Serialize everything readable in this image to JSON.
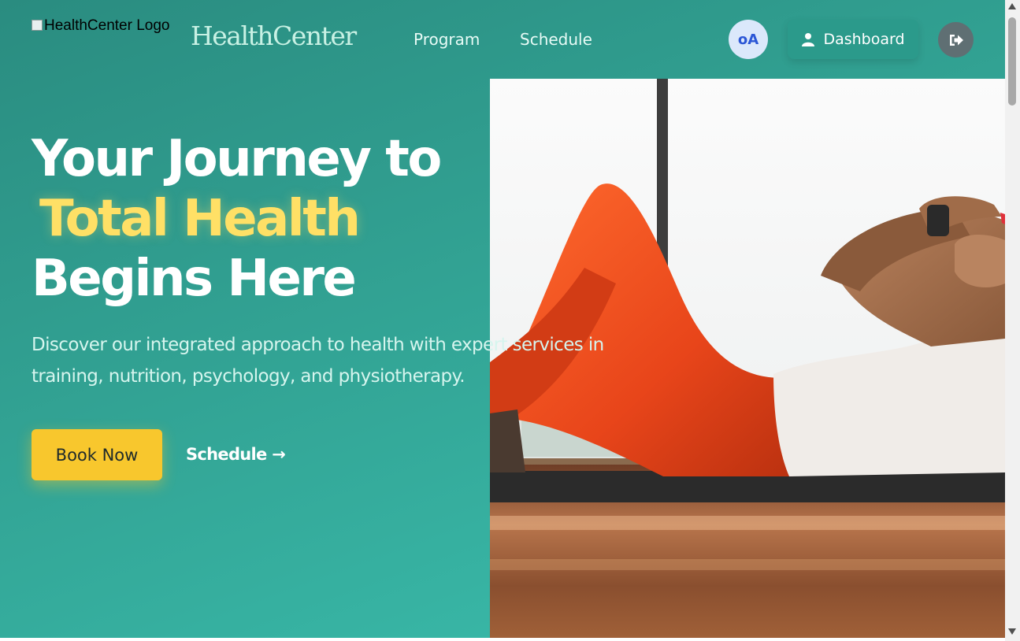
{
  "header": {
    "logo_alt": "HealthCenter Logo",
    "brand": "HealthCenter",
    "nav": [
      {
        "label": "Program"
      },
      {
        "label": "Schedule"
      }
    ],
    "avatar_initials": "oA",
    "dashboard_label": "Dashboard",
    "icons": {
      "dashboard": "user-icon",
      "logout": "sign-out-icon"
    }
  },
  "hero": {
    "title_line1": "Your Journey to",
    "title_accent": "Total Health",
    "title_line3": "Begins Here",
    "description": "Discover our integrated approach to health with expert services in training, nutrition, psychology, and physiotherapy.",
    "book_label": "Book Now",
    "schedule_link": "Schedule →"
  },
  "colors": {
    "background_start": "#2a8c80",
    "background_end": "#3bbfae",
    "accent_yellow": "#ffe066",
    "button_yellow": "#f8c72d",
    "avatar_bg": "#dbe8fb",
    "avatar_text": "#2c57d6"
  }
}
